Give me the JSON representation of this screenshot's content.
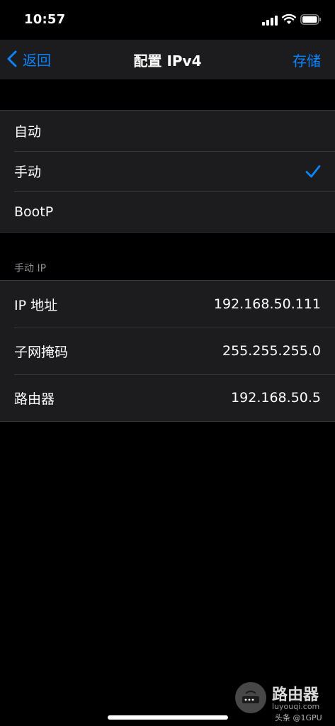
{
  "status_bar": {
    "time": "10:57",
    "icons": [
      "signal-icon",
      "wifi-icon",
      "battery-icon"
    ]
  },
  "nav": {
    "back_label": "返回",
    "title": "配置 IPv4",
    "save_label": "存储",
    "accent_color": "#0a84ff"
  },
  "config_options": [
    {
      "label": "自动",
      "selected": false
    },
    {
      "label": "手动",
      "selected": true
    },
    {
      "label": "BootP",
      "selected": false
    }
  ],
  "manual_ip": {
    "section_header": "手动 IP",
    "fields": [
      {
        "label": "IP 地址",
        "value": "192.168.50.111"
      },
      {
        "label": "子网掩码",
        "value": "255.255.255.0"
      },
      {
        "label": "路由器",
        "value": "192.168.50.5"
      }
    ]
  },
  "watermark": {
    "title": "路由器",
    "url": "luyouqi.com",
    "credit": "头条 @1GPU"
  }
}
